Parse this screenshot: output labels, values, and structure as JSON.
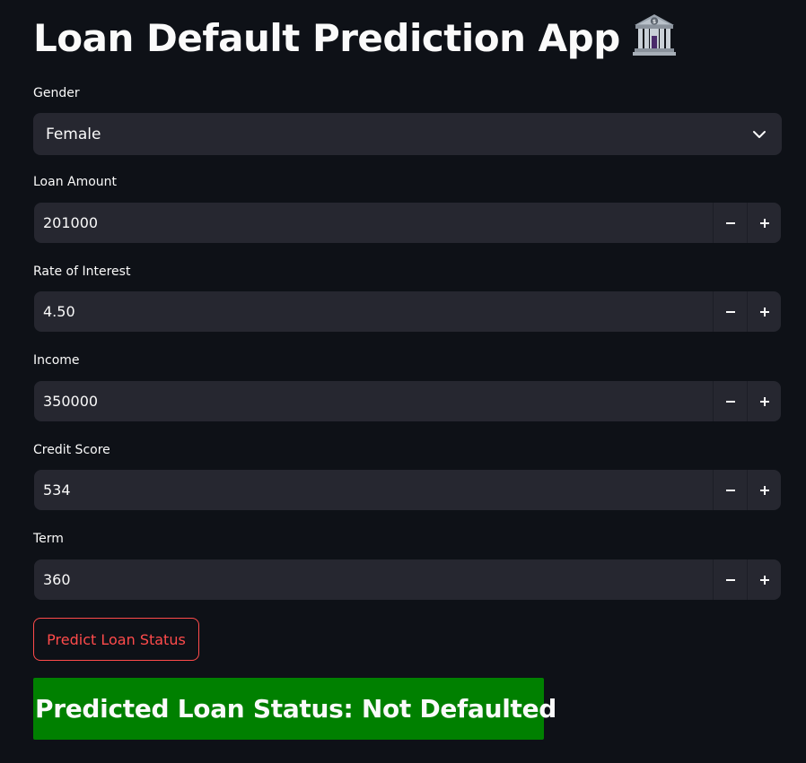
{
  "header": {
    "title": "Loan Default Prediction App",
    "icon": "bank-icon"
  },
  "form": {
    "gender": {
      "label": "Gender",
      "selected": "Female"
    },
    "loan_amount": {
      "label": "Loan Amount",
      "value": "201000"
    },
    "rate_of_interest": {
      "label": "Rate of Interest",
      "value": "4.50"
    },
    "income": {
      "label": "Income",
      "value": "350000"
    },
    "credit_score": {
      "label": "Credit Score",
      "value": "534"
    },
    "term": {
      "label": "Term",
      "value": "360"
    }
  },
  "actions": {
    "predict_label": "Predict Loan Status"
  },
  "result": {
    "text": "Predicted Loan Status: Not Defaulted",
    "color": "#008000"
  },
  "theme": {
    "background": "#0e1117",
    "input_background": "#262730",
    "accent": "#ff4b4b"
  }
}
